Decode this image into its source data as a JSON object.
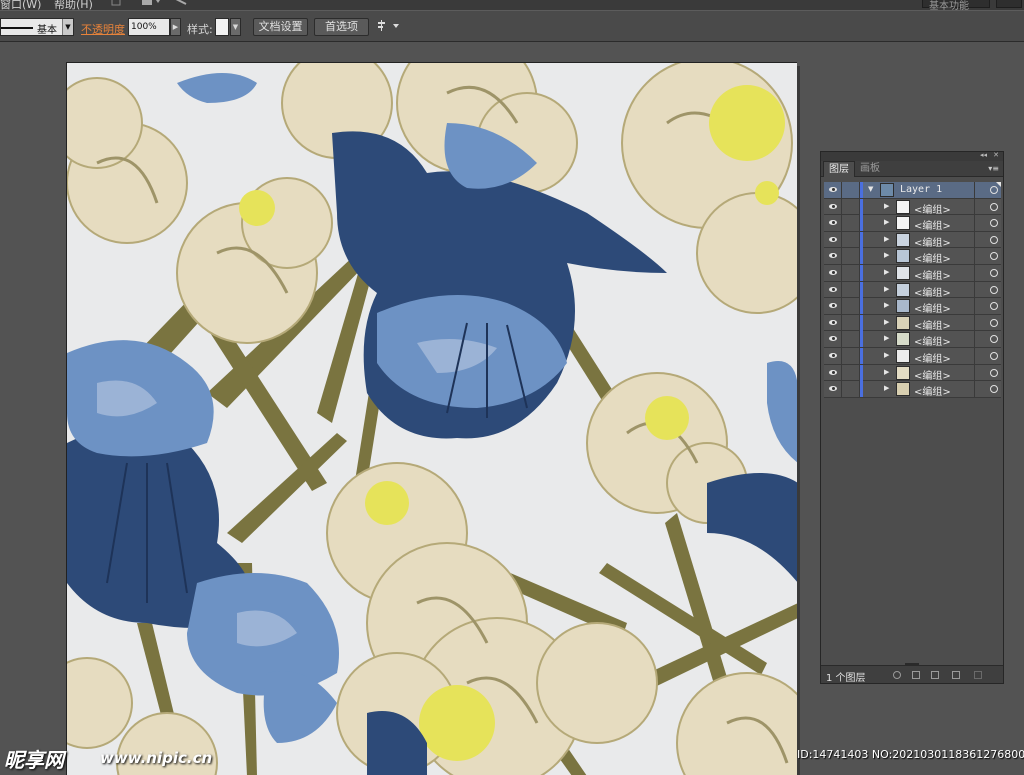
{
  "menubar": {
    "window_menu": "窗口(W)",
    "help_menu": "帮助(H)",
    "workspace": "基本功能"
  },
  "control_bar": {
    "stroke_style": "基本",
    "opacity_label": "不透明度",
    "opacity_value": "100%",
    "style_label": "样式:",
    "doc_setup_button": "文档设置",
    "prefs_button": "首选项"
  },
  "layers_panel": {
    "tabs": [
      "图层",
      "画板"
    ],
    "top_layer": "Layer 1",
    "sublayers": [
      "<编组>",
      "<编组>",
      "<编组>",
      "<编组>",
      "<编组>",
      "<编组>",
      "<编组>",
      "<编组>",
      "<编组>",
      "<编组>",
      "<编组>",
      "<编组>"
    ],
    "layer_count": "1 个图层"
  },
  "watermark": {
    "logo": "昵享网",
    "url": "www.nipic.cn",
    "id_text": "ID:14741403 NO:20210301183612768001"
  },
  "colors": {
    "app_bg": "#535353",
    "artboard_bg": "#e9eaeb",
    "iris_blue": "#4a6fa0",
    "stem_olive": "#7a7440",
    "petal_cream": "#e6dcc0",
    "center_yellow": "#e6e35a",
    "highlight_orange": "#e8833a"
  },
  "icons": [
    "eye-icon",
    "disclosure-triangle-icon",
    "target-circle-icon",
    "panel-menu-icon",
    "new-layer-icon",
    "delete-layer-icon"
  ]
}
